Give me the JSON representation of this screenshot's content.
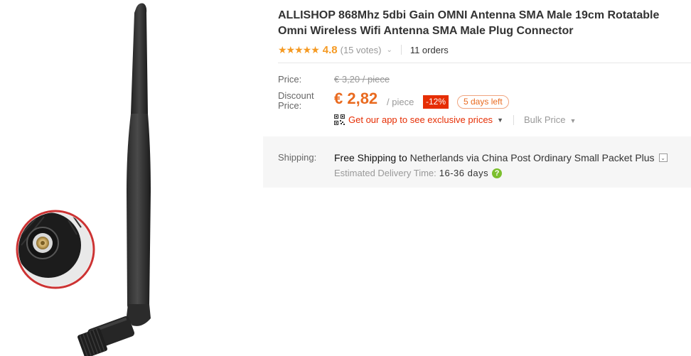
{
  "product": {
    "title": "ALLISHOP 868Mhz 5dbi Gain OMNI Antenna SMA Male 19cm Rotatable Omni Wireless Wifi Antenna SMA Male Plug Connector",
    "image_subject": "black rubber duck antenna with SMA male connector close-up"
  },
  "rating": {
    "stars": "★★★★★",
    "score": "4.8",
    "votes": "(15 votes)",
    "chevron": "⌄",
    "orders": "11 orders",
    "star_color": "#f59a23"
  },
  "price": {
    "price_label": "Price:",
    "original": "€ 3,20 / piece",
    "discount_label_line1": "Discount",
    "discount_label_line2": "Price:",
    "current": "€ 2,82",
    "unit": "/ piece",
    "discount_badge": "-12%",
    "time_left": "5 days left",
    "app_promo": "Get our app to see exclusive prices",
    "bulk": "Bulk Price",
    "accent_color": "#e96a1f",
    "badge_color": "#e62e04"
  },
  "shipping": {
    "label": "Shipping:",
    "free_text": "Free Shipping to",
    "destination": "Netherlands via China Post Ordinary Small Packet Plus",
    "toggle": "⌄",
    "estimate_label": "Estimated Delivery Time:",
    "estimate_days": "16-36 days",
    "help": "?"
  },
  "icons": {
    "qr": "qr-code-icon",
    "help": "question-icon",
    "dropdown": "caret-down-icon"
  }
}
